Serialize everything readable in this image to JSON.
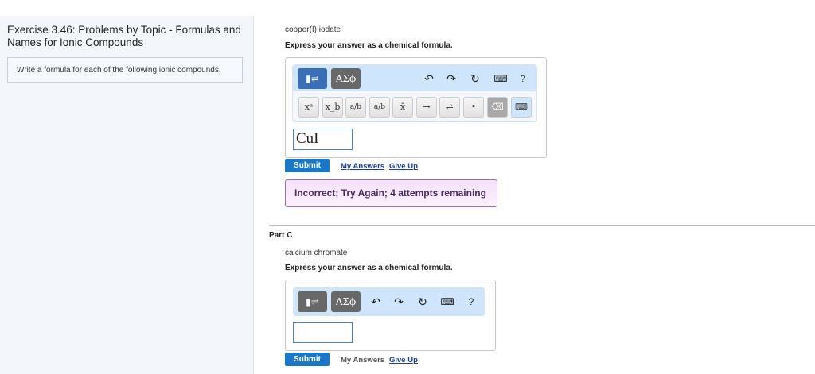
{
  "sidebar": {
    "title": "Exercise 3.46: Problems by Topic - Formulas and Names for Ionic Compounds",
    "instructions": "Write a formula for each of the following ionic compounds."
  },
  "partB": {
    "compound": "copper(I) iodate",
    "prompt": "Express your answer as a chemical formula.",
    "answer": "CuI",
    "submit": "Submit",
    "my_answers": "My Answers",
    "give_up": "Give Up",
    "feedback": "Incorrect; Try Again; 4 attempts remaining"
  },
  "partC": {
    "label": "Part C",
    "compound": "calcium chromate",
    "prompt": "Express your answer as a chemical formula.",
    "answer": "",
    "submit": "Submit",
    "my_answers": "My Answers",
    "give_up": "Give Up"
  },
  "toolbar": {
    "greek": "ΑΣϕ",
    "help": "?",
    "keys": [
      "xᵃ",
      "x_b",
      "a/b",
      "a/b",
      "x̄",
      "→",
      "⇌",
      "•"
    ]
  }
}
